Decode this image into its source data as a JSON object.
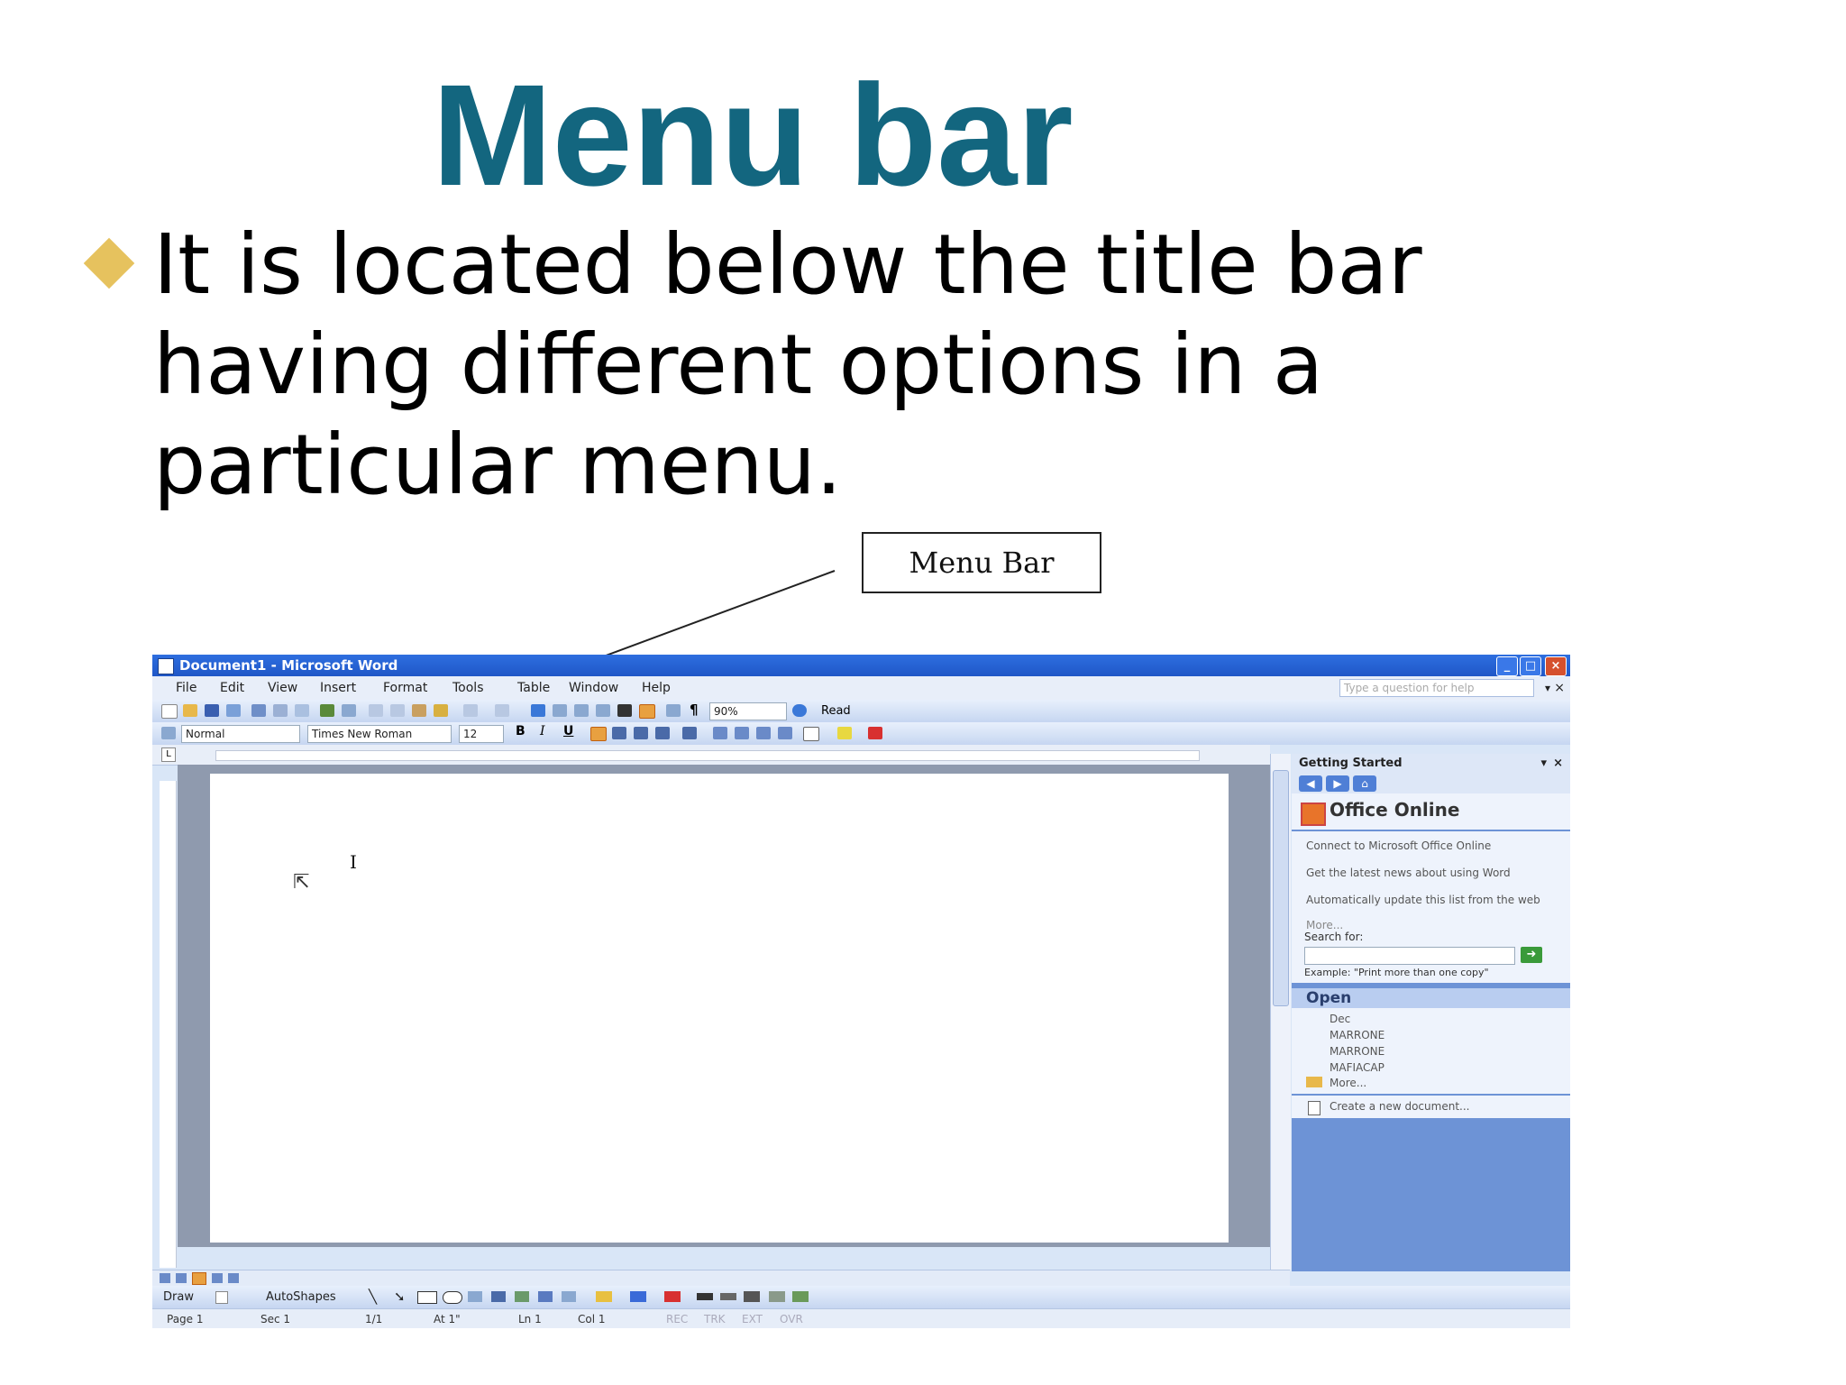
{
  "slide": {
    "title": "Menu bar",
    "bullet": "It is located below the title bar having different options in a particular menu.",
    "callout": "Menu Bar"
  },
  "word": {
    "title_bar": "Document1 - Microsoft Word",
    "window_buttons": {
      "minimize": "_",
      "maximize": "□",
      "close": "×"
    },
    "menus": [
      "File",
      "Edit",
      "View",
      "Insert",
      "Format",
      "Tools",
      "Table",
      "Window",
      "Help"
    ],
    "help_placeholder": "Type a question for help",
    "toolbar": {
      "zoom": "90%",
      "read": "Read",
      "style": "Normal",
      "font": "Times New Roman",
      "size": "12",
      "bold": "B",
      "italic": "I",
      "underline": "U",
      "pilcrow": "¶"
    },
    "task_pane": {
      "title": "Getting Started",
      "office_online": "Office Online",
      "links": [
        "Connect to Microsoft Office Online",
        "Get the latest news about using Word",
        "Automatically update this list from the web"
      ],
      "more": "More...",
      "search_label": "Search for:",
      "example": "Example: \"Print more than one copy\"",
      "open_heading": "Open",
      "open_files": [
        "Dec",
        "MARRONE",
        "MARRONE",
        "MAFIACAP"
      ],
      "open_more": "More...",
      "create": "Create a new document..."
    },
    "draw_toolbar": {
      "draw": "Draw",
      "autoshapes": "AutoShapes"
    },
    "status": {
      "page": "Page 1",
      "sec": "Sec 1",
      "pages": "1/1",
      "at": "At 1\"",
      "ln": "Ln 1",
      "col": "Col 1",
      "modes": [
        "REC",
        "TRK",
        "EXT",
        "OVR"
      ]
    }
  },
  "colors": {
    "title": "#13667f",
    "bullet": "#e6c25e",
    "titlebar": "#1f57c7",
    "taskpane": "#6d93d6"
  }
}
